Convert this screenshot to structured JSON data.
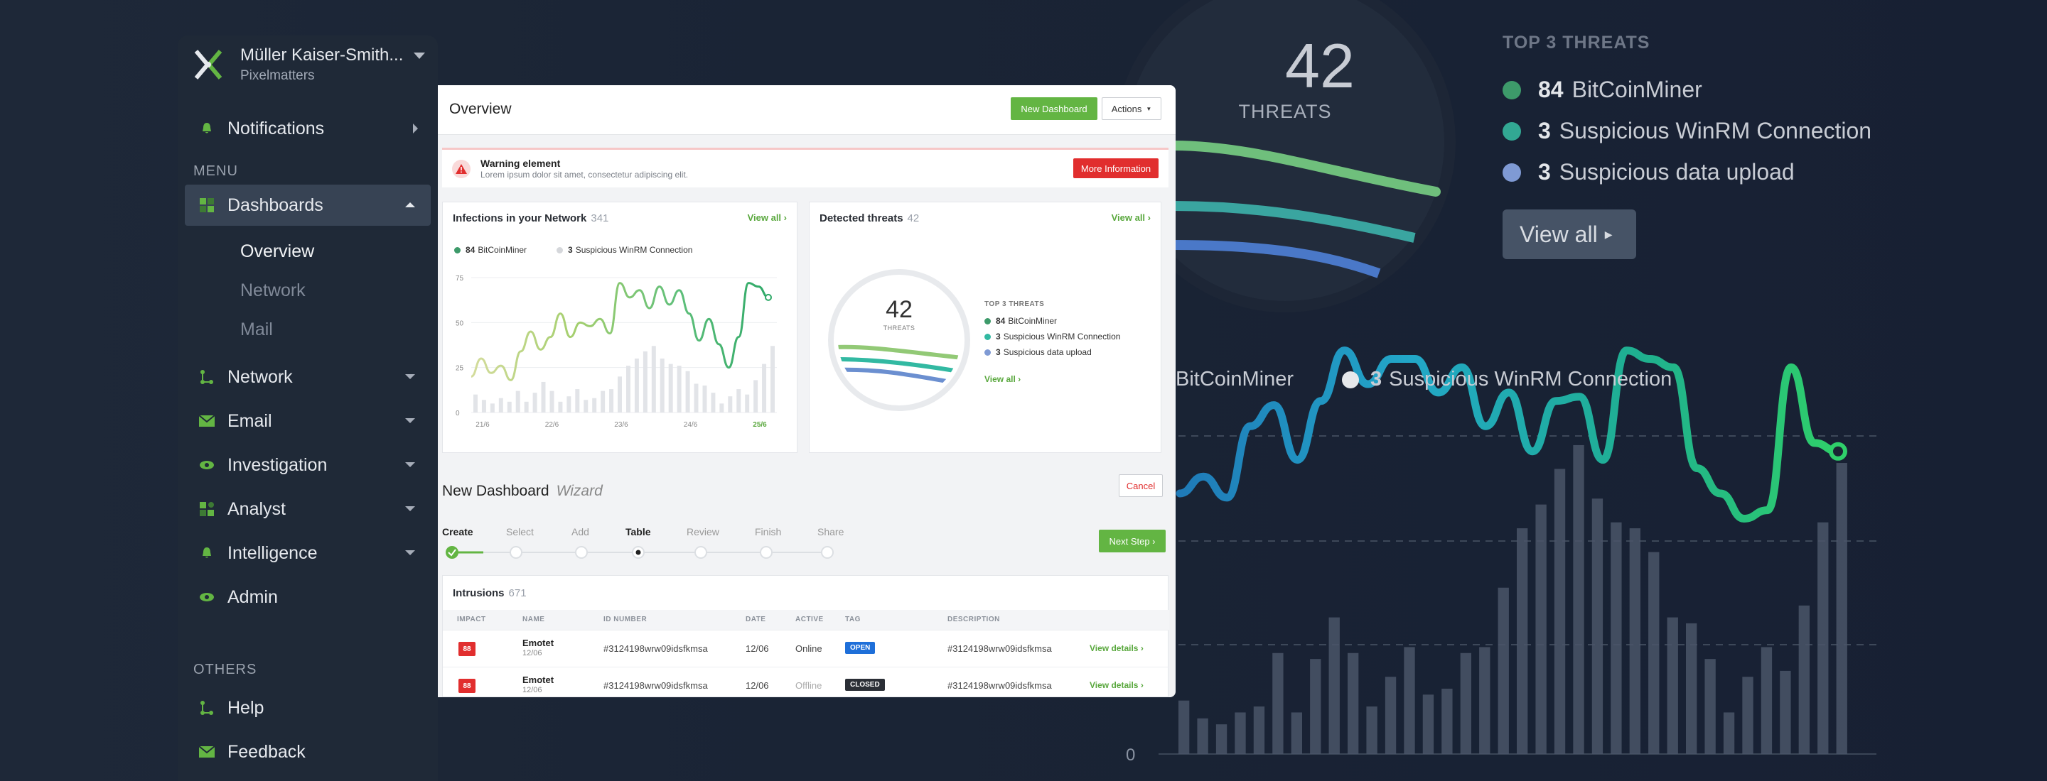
{
  "background": {
    "threats_count": "42",
    "threats_label": "THREATS",
    "top_title": "TOP 3 THREATS",
    "top": [
      {
        "count": "84",
        "name": "BitCoinMiner",
        "color": "#3d9a6a"
      },
      {
        "count": "3",
        "name": "Suspicious WinRM Connection",
        "color": "#32a893"
      },
      {
        "count": "3",
        "name": "Suspicious data upload",
        "color": "#7f9ad4"
      }
    ],
    "view_all": "View all",
    "legend": [
      {
        "count": "",
        "name": "BitCoinMiner"
      },
      {
        "count": "3",
        "name": "Suspicious WinRM Connection"
      }
    ],
    "zero_label": "0",
    "chart_line": [
      62,
      66,
      61,
      78,
      83,
      70,
      84,
      96,
      88,
      94,
      94,
      86,
      92,
      78,
      86,
      72,
      84,
      85,
      70,
      96,
      94,
      92,
      68,
      62,
      56,
      58,
      92,
      74,
      72
    ],
    "chart_bars": [
      9,
      6,
      5,
      7,
      8,
      17,
      7,
      16,
      23,
      17,
      8,
      13,
      18,
      10,
      11,
      17,
      18,
      28,
      38,
      42,
      48,
      52,
      43,
      39,
      38,
      34,
      23,
      22,
      16,
      7,
      13,
      18,
      14,
      25,
      39,
      49
    ]
  },
  "sidebar": {
    "user_name": "Müller Kaiser-Smith...",
    "org": "Pixelmatters",
    "notifications": "Notifications",
    "menu_section": "MENU",
    "dashboards": "Dashboards",
    "sub": {
      "overview": "Overview",
      "network": "Network",
      "mail": "Mail"
    },
    "items": {
      "network": "Network",
      "email": "Email",
      "investigation": "Investigation",
      "analyst": "Analyst",
      "intelligence": "Intelligence",
      "admin": "Admin"
    },
    "others_section": "OTHERS",
    "help": "Help",
    "feedback": "Feedback"
  },
  "panel": {
    "title": "Overview",
    "new_dashboard": "New Dashboard",
    "actions": "Actions",
    "warning_title": "Warning element",
    "warning_text": "Lorem ipsum dolor sit amet, consectetur adipiscing elit.",
    "more_info": "More Information",
    "infections": {
      "title": "Infections in your Network",
      "count": "341",
      "view_all": "View all ›",
      "legend": [
        {
          "count": "84",
          "name": "BitCoinMiner",
          "color": "#3d9a6a"
        },
        {
          "count": "3",
          "name": "Suspicious WinRM Connection",
          "color": "#d5d7db"
        }
      ]
    },
    "detected": {
      "title": "Detected threats",
      "count": "42",
      "view_all": "View all ›",
      "number": "42",
      "label": "THREATS",
      "top_title": "TOP 3 THREATS",
      "top": [
        {
          "count": "84",
          "name": "BitCoinMiner",
          "color": "#3d9a6a"
        },
        {
          "count": "3",
          "name": "Suspicious WinRM Connection",
          "color": "#32b9a2"
        },
        {
          "count": "3",
          "name": "Suspicious data upload",
          "color": "#7f9ad4"
        }
      ],
      "view_all_link": "View all ›"
    },
    "wizard": {
      "title": "New Dashboard",
      "subtitle": "Wizard",
      "cancel": "Cancel",
      "next": "Next Step ›",
      "steps": [
        "Create",
        "Select",
        "Add",
        "Table",
        "Review",
        "Finish",
        "Share"
      ]
    },
    "intrusions": {
      "title": "Intrusions",
      "count": "671",
      "headers": [
        "IMPACT",
        "NAME",
        "ID NUMBER",
        "DATE",
        "ACTIVE",
        "TAG",
        "DESCRIPTION"
      ],
      "rows": [
        {
          "impact": "88",
          "name": "Emotet",
          "date_sub": "12/06",
          "id": "#3124198wrw09idsfkmsa",
          "date": "12/06",
          "active": "Online",
          "tag": "OPEN",
          "tag_color": "#1e6fd9",
          "desc": "#3124198wrw09idsfkmsa",
          "action": "View details ›"
        },
        {
          "impact": "88",
          "name": "Emotet",
          "date_sub": "12/06",
          "id": "#3124198wrw09idsfkmsa",
          "date": "12/06",
          "active": "Offline",
          "tag": "CLOSED",
          "tag_color": "#2b2f36",
          "desc": "#3124198wrw09idsfkmsa",
          "action": "View details ›"
        }
      ]
    }
  },
  "chart_data": {
    "type": "line",
    "x_ticks": [
      "21/6",
      "22/6",
      "23/6",
      "24/6",
      "25/6"
    ],
    "y_ticks": [
      "0",
      "25",
      "50",
      "75"
    ],
    "ylim": [
      0,
      75
    ],
    "series": [
      {
        "name": "BitCoinMiner",
        "type": "line",
        "values": [
          20,
          30,
          22,
          26,
          18,
          34,
          45,
          35,
          42,
          55,
          42,
          50,
          48,
          52,
          44,
          72,
          64,
          68,
          58,
          70,
          60,
          68,
          55,
          40,
          52,
          38,
          25,
          42,
          72,
          70,
          64
        ]
      },
      {
        "name": "Suspicious WinRM Connection",
        "type": "bar",
        "values": [
          10,
          7,
          5,
          8,
          6,
          12,
          6,
          11,
          17,
          12,
          6,
          9,
          13,
          7,
          8,
          12,
          13,
          20,
          26,
          30,
          34,
          37,
          30,
          27,
          26,
          23,
          16,
          15,
          11,
          5,
          9,
          13,
          10,
          18,
          27,
          37
        ]
      }
    ]
  }
}
